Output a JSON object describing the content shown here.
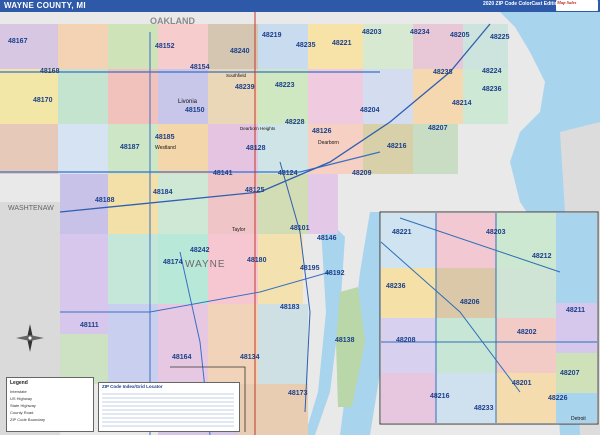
{
  "header": {
    "title": "WAYNE COUNTY, MI",
    "edition": "2020 ZIP Code ColorCast Edition",
    "logo": "Map Sales"
  },
  "regions": {
    "oakland": "OAKLAND",
    "washtenaw": "WASHTENAW",
    "wayne": "WAYNE"
  },
  "cities": {
    "livonia": "Livonia",
    "westland": "Westland",
    "taylor": "Taylor",
    "dearborn": "Dearborn",
    "dearborn_heights": "Dearborn Heights",
    "detroit": "Detroit",
    "southfield": "Southfield"
  },
  "zips": [
    {
      "code": "48167",
      "id": "z48167"
    },
    {
      "code": "48152",
      "id": "z48152"
    },
    {
      "code": "48240",
      "id": "z48240"
    },
    {
      "code": "48219",
      "id": "z48219"
    },
    {
      "code": "48235",
      "id": "z48235"
    },
    {
      "code": "48221",
      "id": "z48221"
    },
    {
      "code": "48203",
      "id": "z48203"
    },
    {
      "code": "48234",
      "id": "z48234"
    },
    {
      "code": "48205",
      "id": "z48205"
    },
    {
      "code": "48225",
      "id": "z48225"
    },
    {
      "code": "48168",
      "id": "z48168"
    },
    {
      "code": "48154",
      "id": "z48154"
    },
    {
      "code": "48239",
      "id": "z48239"
    },
    {
      "code": "48223",
      "id": "z48223"
    },
    {
      "code": "48238",
      "id": "z48238"
    },
    {
      "code": "48224",
      "id": "z48224"
    },
    {
      "code": "48236",
      "id": "z48236"
    },
    {
      "code": "48170",
      "id": "z48170"
    },
    {
      "code": "48150",
      "id": "z48150"
    },
    {
      "code": "48228",
      "id": "z48228"
    },
    {
      "code": "48204",
      "id": "z48204"
    },
    {
      "code": "48214",
      "id": "z48214"
    },
    {
      "code": "48126",
      "id": "z48126"
    },
    {
      "code": "48207",
      "id": "z48207"
    },
    {
      "code": "48185",
      "id": "z48185"
    },
    {
      "code": "48187",
      "id": "z48187"
    },
    {
      "code": "48128",
      "id": "z48128"
    },
    {
      "code": "48216",
      "id": "z48216"
    },
    {
      "code": "48141",
      "id": "z48141"
    },
    {
      "code": "48124",
      "id": "z48124"
    },
    {
      "code": "48209",
      "id": "z48209"
    },
    {
      "code": "48184",
      "id": "z48184"
    },
    {
      "code": "48125",
      "id": "z48125"
    },
    {
      "code": "48188",
      "id": "z48188"
    },
    {
      "code": "48101",
      "id": "z48101"
    },
    {
      "code": "48146",
      "id": "z48146"
    },
    {
      "code": "48242",
      "id": "z48242"
    },
    {
      "code": "48174",
      "id": "z48174"
    },
    {
      "code": "48180",
      "id": "z48180"
    },
    {
      "code": "48195",
      "id": "z48195"
    },
    {
      "code": "48192",
      "id": "z48192"
    },
    {
      "code": "48111",
      "id": "z48111"
    },
    {
      "code": "48183",
      "id": "z48183"
    },
    {
      "code": "48164",
      "id": "z48164"
    },
    {
      "code": "48134",
      "id": "z48134"
    },
    {
      "code": "48173",
      "id": "z48173"
    },
    {
      "code": "48138",
      "id": "z48138"
    }
  ],
  "inset_zips": [
    {
      "code": "48221"
    },
    {
      "code": "48203"
    },
    {
      "code": "48212"
    },
    {
      "code": "48236"
    },
    {
      "code": "48206"
    },
    {
      "code": "48211"
    },
    {
      "code": "48202"
    },
    {
      "code": "48208"
    },
    {
      "code": "48201"
    },
    {
      "code": "48216"
    },
    {
      "code": "48226"
    },
    {
      "code": "48207"
    },
    {
      "code": "48233"
    }
  ],
  "legend": {
    "title": "ZIP Code Index/Grid Locator",
    "heading": "Legend",
    "items": [
      "Interstate",
      "US Highway",
      "State Highway",
      "County Road",
      "ZIP Code Boundary"
    ]
  }
}
